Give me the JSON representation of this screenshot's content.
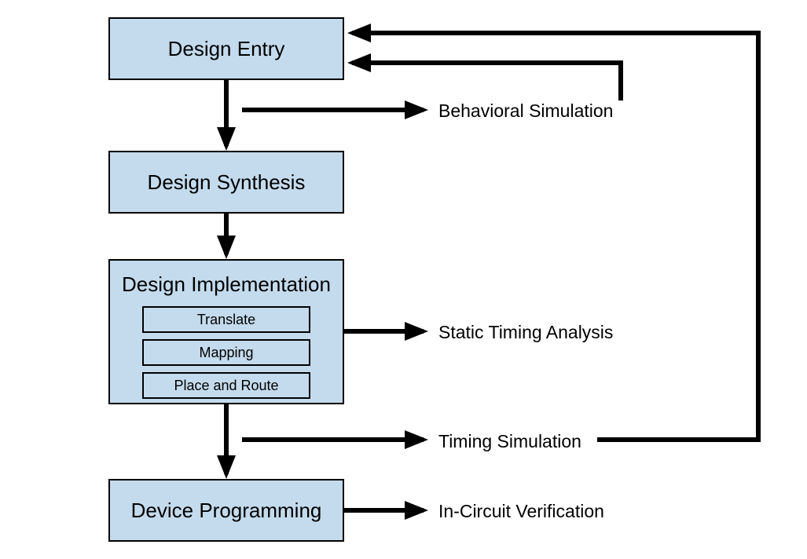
{
  "boxes": {
    "design_entry": "Design Entry",
    "design_synthesis": "Design Synthesis",
    "design_implementation": "Design Implementation",
    "device_programming": "Device Programming"
  },
  "implementation_steps": {
    "translate": "Translate",
    "mapping": "Mapping",
    "place_route": "Place and Route"
  },
  "side_labels": {
    "behavioral_simulation": "Behavioral Simulation",
    "static_timing": "Static Timing Analysis",
    "timing_simulation": "Timing Simulation",
    "in_circuit": "In-Circuit Verification"
  },
  "colors": {
    "box_fill": "#c4dbed",
    "stroke": "#000000"
  }
}
